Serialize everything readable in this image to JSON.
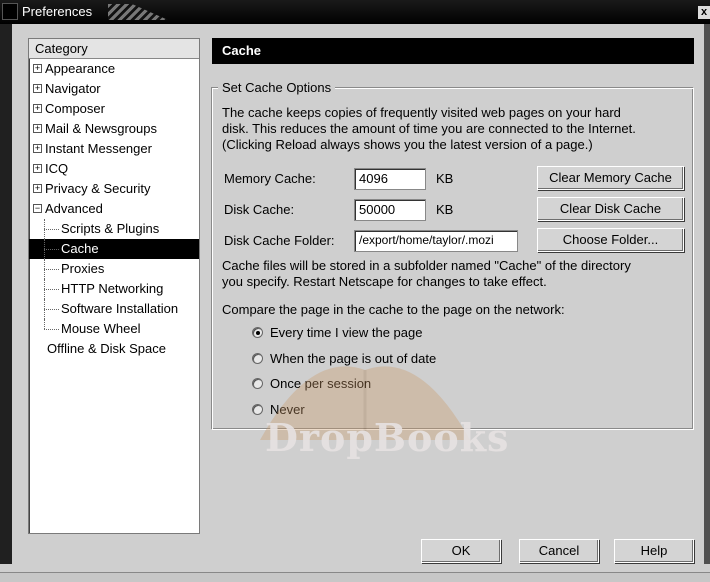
{
  "window": {
    "title": "Preferences",
    "close_glyph": "x"
  },
  "category": {
    "header": "Category",
    "items": [
      {
        "label": "Appearance",
        "expander": "+"
      },
      {
        "label": "Navigator",
        "expander": "+"
      },
      {
        "label": "Composer",
        "expander": "+"
      },
      {
        "label": "Mail & Newsgroups",
        "expander": "+"
      },
      {
        "label": "Instant Messenger",
        "expander": "+"
      },
      {
        "label": "ICQ",
        "expander": "+"
      },
      {
        "label": "Privacy & Security",
        "expander": "+"
      },
      {
        "label": "Advanced",
        "expander": "−"
      }
    ],
    "advanced_children": [
      "Scripts & Plugins",
      "Cache",
      "Proxies",
      "HTTP Networking",
      "Software Installation",
      "Mouse Wheel"
    ],
    "selected": "Cache",
    "offline": "Offline & Disk Space"
  },
  "panel": {
    "title": "Cache",
    "group_label": "Set Cache Options",
    "description_lines": [
      "The cache keeps copies of frequently visited web pages on your hard",
      "disk. This reduces the amount of time you are connected to the Internet.",
      "(Clicking Reload always shows you the latest version of a page.)"
    ],
    "memory_cache_label": "Memory Cache:",
    "memory_cache_value": "4096",
    "memory_unit": "KB",
    "clear_memory_button": "Clear Memory Cache",
    "disk_cache_label": "Disk Cache:",
    "disk_cache_value": "50000",
    "disk_unit": "KB",
    "clear_disk_button": "Clear Disk Cache",
    "folder_label": "Disk Cache Folder:",
    "folder_value": "/export/home/taylor/.mozi",
    "choose_folder_button": "Choose Folder...",
    "folder_note_lines": [
      "Cache files will be stored in a subfolder named \"Cache\" of the directory",
      "you specify. Restart Netscape for changes to take effect."
    ],
    "compare_label": "Compare the page in the cache to the page on the network:",
    "compare_options": [
      {
        "label": "Every time I view the page",
        "checked": true
      },
      {
        "label": "When the page is out of date",
        "checked": false
      },
      {
        "label": "Once per session",
        "checked": false
      },
      {
        "label": "Never",
        "checked": false
      }
    ]
  },
  "footer": {
    "ok_button": "OK",
    "cancel_button": "Cancel",
    "help_button": "Help"
  },
  "watermark": "DropBooks"
}
